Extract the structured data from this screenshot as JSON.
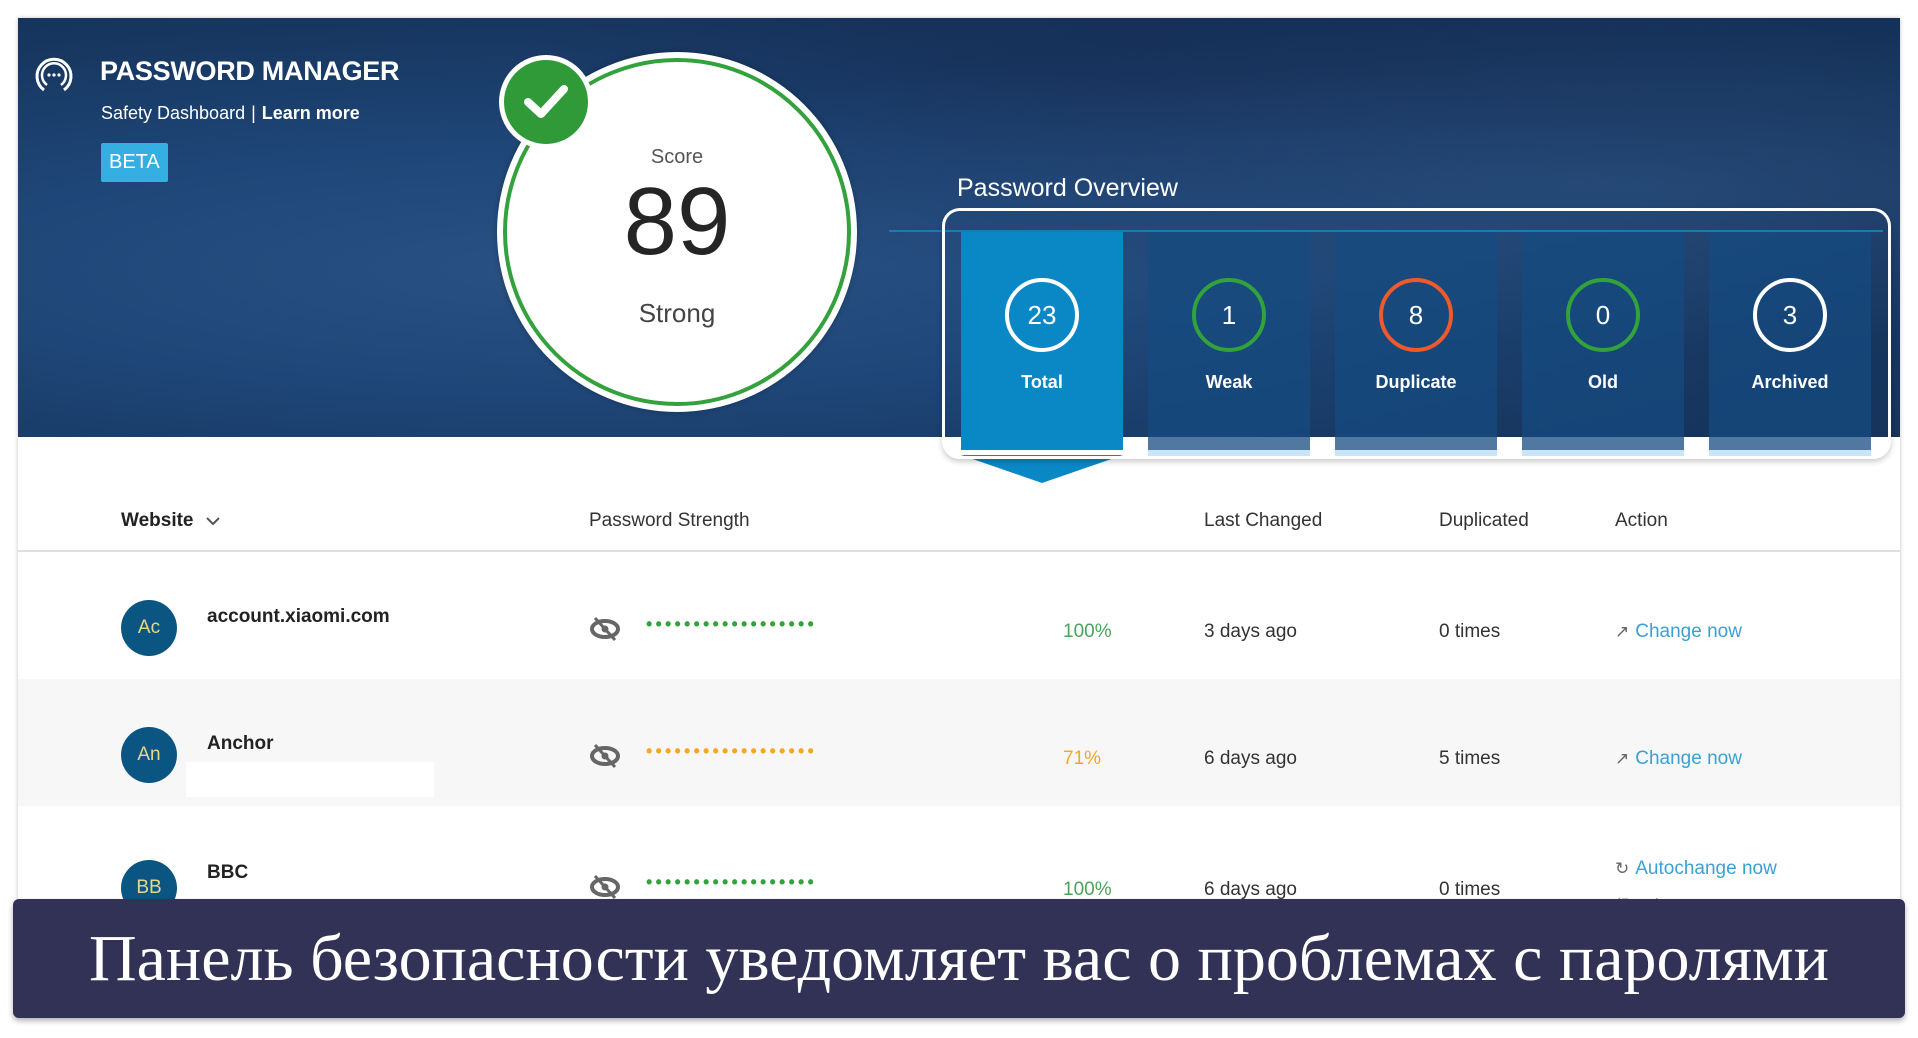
{
  "brand": {
    "title": "PASSWORD MANAGER",
    "subtitle": "Safety Dashboard",
    "separator": "|",
    "learn_more": "Learn more",
    "beta": "BETA"
  },
  "score": {
    "label": "Score",
    "value": "89",
    "rating": "Strong"
  },
  "overview": {
    "title": "Password Overview",
    "tiles": [
      {
        "count": "23",
        "label": "Total",
        "ring_color": "#ffffff",
        "active": true
      },
      {
        "count": "1",
        "label": "Weak",
        "ring_color": "#33a23c",
        "active": false
      },
      {
        "count": "8",
        "label": "Duplicate",
        "ring_color": "#ee5a2b",
        "active": false
      },
      {
        "count": "0",
        "label": "Old",
        "ring_color": "#33a23c",
        "active": false
      },
      {
        "count": "3",
        "label": "Archived",
        "ring_color": "#ffffff",
        "active": false
      }
    ]
  },
  "table": {
    "headers": {
      "website": "Website",
      "strength": "Password Strength",
      "last_changed": "Last Changed",
      "duplicated": "Duplicated",
      "action": "Action"
    },
    "rows": [
      {
        "initials": "Ac",
        "site": "account.xiaomi.com",
        "masked": "••••••••••••••••••",
        "strength": "100%",
        "strength_color": "#33a23c",
        "pct_color": "#4aa35a",
        "last_changed": "3 days ago",
        "duplicated": "0 times",
        "action": "Change now",
        "action_icon": "external-link-icon"
      },
      {
        "initials": "An",
        "site": "Anchor",
        "masked": "••••••••••••••••••",
        "strength": "71%",
        "strength_color": "#f5a623",
        "pct_color": "#f5a623",
        "last_changed": "6 days ago",
        "duplicated": "5 times",
        "action": "Change now",
        "action_icon": "external-link-icon"
      },
      {
        "initials": "BB",
        "site": "BBC",
        "masked": "••••••••••••••••••",
        "strength": "100%",
        "strength_color": "#33a23c",
        "pct_color": "#4aa35a",
        "last_changed": "6 days ago",
        "duplicated": "0 times",
        "action": "Autochange now",
        "action_icon": "refresh-icon",
        "action_note": "(Beta)"
      }
    ]
  },
  "caption": "Панель безопасности уведомляет вас о проблемах с паролями"
}
